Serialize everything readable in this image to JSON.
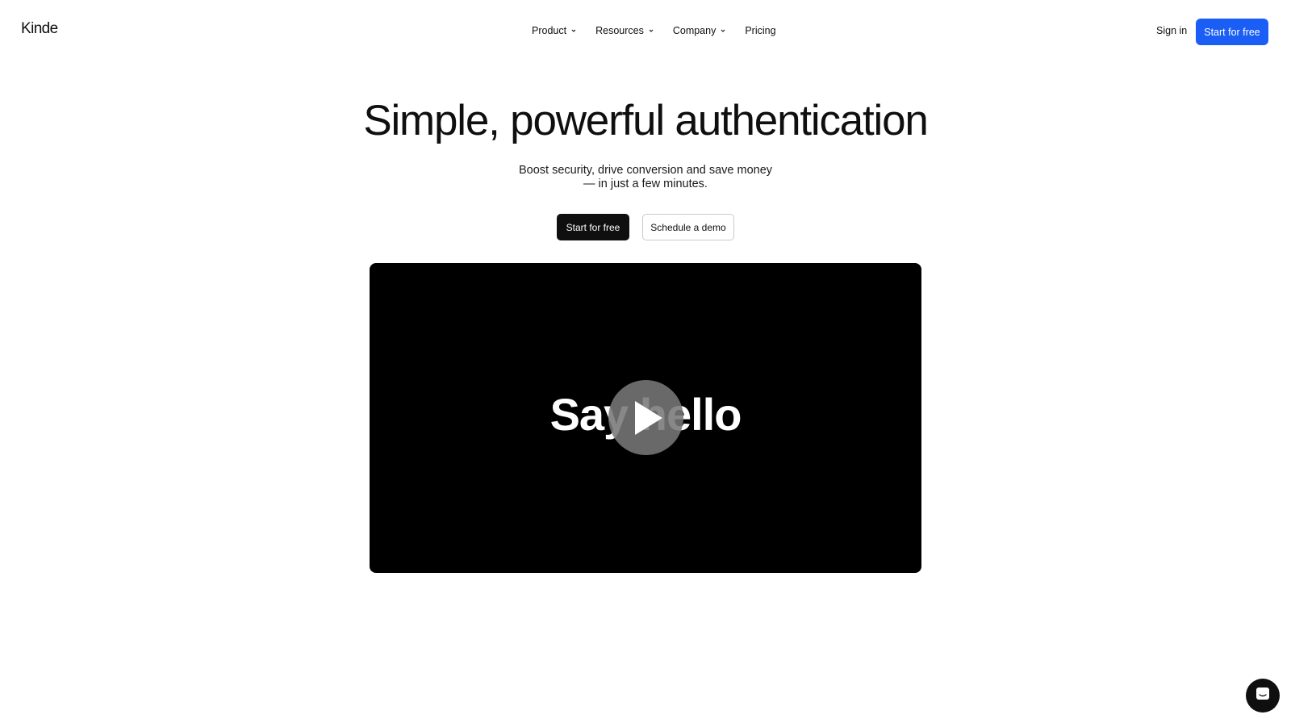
{
  "header": {
    "logo": "Kinde",
    "nav": [
      {
        "label": "Product",
        "has_dropdown": true
      },
      {
        "label": "Resources",
        "has_dropdown": true
      },
      {
        "label": "Company",
        "has_dropdown": true
      },
      {
        "label": "Pricing",
        "has_dropdown": false
      }
    ],
    "sign_in": "Sign in",
    "start_for_free": "Start for free"
  },
  "hero": {
    "title": "Simple, powerful authentication",
    "subtitle_line1": "Boost security, drive conversion and save money",
    "subtitle_line2": "— in just a few minutes.",
    "primary_cta": "Start for free",
    "secondary_cta": "Schedule a demo"
  },
  "video": {
    "overlay_text": "Say hello",
    "play_icon": "play-icon"
  },
  "chat": {
    "icon": "chat-icon"
  },
  "colors": {
    "accent": "#1a5ef6",
    "dark": "#0f0f0f",
    "video_bg": "#000000"
  }
}
